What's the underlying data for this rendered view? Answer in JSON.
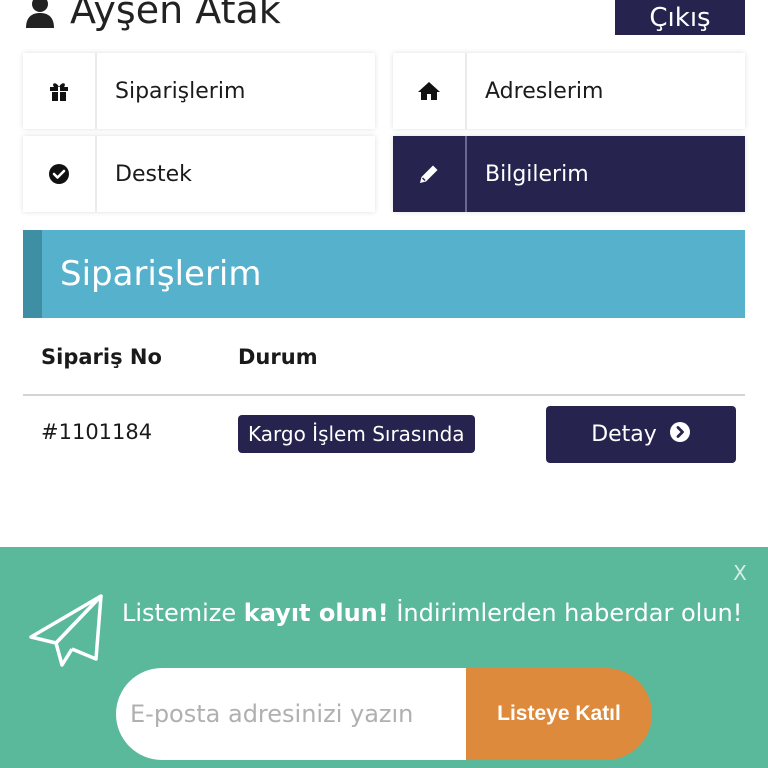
{
  "header": {
    "user_name": "Ayşen Atak",
    "logout_label": "Çıkış"
  },
  "menu": {
    "orders": {
      "label": "Siparişlerim",
      "icon": "gift-icon"
    },
    "addresses": {
      "label": "Adreslerim",
      "icon": "home-icon"
    },
    "support": {
      "label": "Destek",
      "icon": "check-circle-icon"
    },
    "info": {
      "label": "Bilgilerim",
      "icon": "pencil-icon",
      "active": true
    }
  },
  "section": {
    "title": "Siparişlerim"
  },
  "orders_table": {
    "headers": {
      "order_no": "Sipariş No",
      "status": "Durum"
    },
    "rows": [
      {
        "order_no": "#1101184",
        "status": "Kargo İşlem Sırasında",
        "detail_label": "Detay"
      }
    ]
  },
  "newsletter": {
    "text_before": "Listemize ",
    "text_bold": "kayıt olun!",
    "text_after": " İndirimlerden haberdar olun!",
    "email_placeholder": "E-posta adresinizi yazın",
    "join_label": "Listeye Katıl",
    "close_label": "X"
  },
  "colors": {
    "brand_dark": "#26244f",
    "section_blue": "#56b2cc",
    "newsletter_green": "#5ab99a",
    "join_orange": "#dd8a3c"
  }
}
